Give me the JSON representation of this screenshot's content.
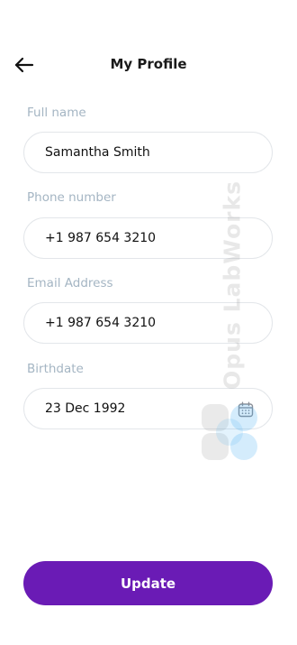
{
  "header": {
    "title": "My Profile",
    "back_icon": "arrow-left-icon"
  },
  "form": {
    "fields": [
      {
        "label": "Full name",
        "value": "Samantha Smith"
      },
      {
        "label": "Phone number",
        "value": "+1 987 654 3210"
      },
      {
        "label": "Email Address",
        "value": "+1 987 654 3210"
      },
      {
        "label": "Birthdate",
        "value": "23 Dec 1992",
        "icon": "calendar-icon"
      }
    ]
  },
  "actions": {
    "update_label": "Update"
  },
  "watermark": {
    "text": "Opus LabWorks"
  },
  "colors": {
    "accent": "#6a1bb5",
    "label": "#a4b5c3",
    "field_border": "#e3e6ea"
  }
}
